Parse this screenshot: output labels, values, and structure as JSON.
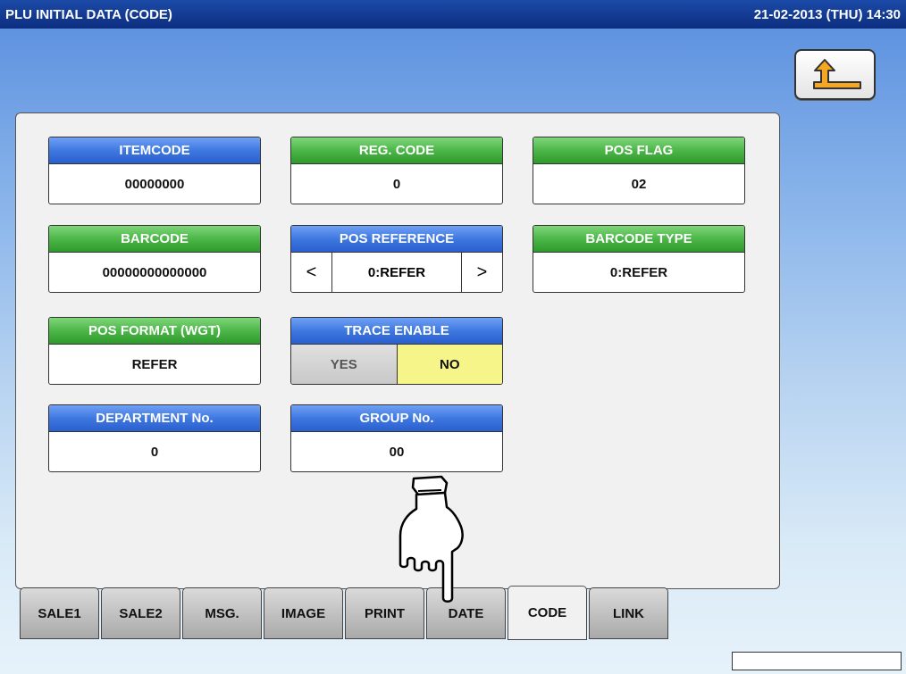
{
  "header": {
    "title": "PLU INITIAL DATA (CODE)",
    "datetime": "21-02-2013 (THU)  14:30"
  },
  "fields": {
    "itemcode": {
      "label": "ITEMCODE",
      "value": "00000000"
    },
    "reg_code": {
      "label": "REG. CODE",
      "value": "0"
    },
    "pos_flag": {
      "label": "POS FLAG",
      "value": "02"
    },
    "barcode": {
      "label": "BARCODE",
      "value": "00000000000000"
    },
    "pos_reference": {
      "label": "POS REFERENCE",
      "value": "0:REFER",
      "prev": "<",
      "next": ">"
    },
    "barcode_type": {
      "label": "BARCODE TYPE",
      "value": "0:REFER"
    },
    "pos_format": {
      "label": "POS FORMAT (WGT)",
      "value": "REFER"
    },
    "trace_enable": {
      "label": "TRACE ENABLE",
      "yes": "YES",
      "no": "NO",
      "selected": "NO"
    },
    "department": {
      "label": "DEPARTMENT No.",
      "value": "0"
    },
    "group": {
      "label": "GROUP No.",
      "value": "00"
    }
  },
  "tabs": [
    "SALE1",
    "SALE2",
    "MSG.",
    "IMAGE",
    "PRINT",
    "DATE",
    "CODE",
    "LINK"
  ],
  "active_tab": "CODE",
  "colors": {
    "title_bar": "#0c2e80",
    "header_blue": "#3f78e0",
    "header_green": "#4cb648",
    "selected_yellow": "#f5f58a"
  },
  "icons": {
    "back": "return-arrow-icon",
    "pointer": "pointing-hand-icon"
  }
}
